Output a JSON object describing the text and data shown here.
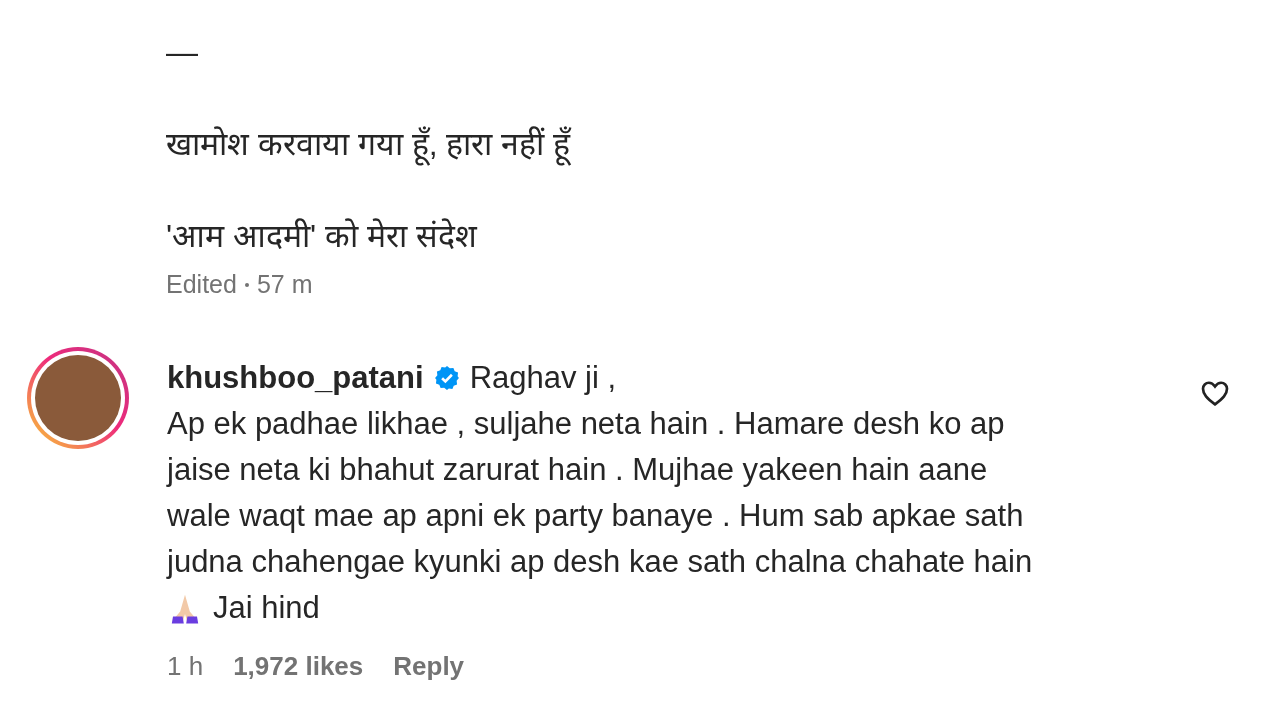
{
  "caption": {
    "lines": [
      "—",
      "खामोश करवाया गया हूँ, हारा नहीं हूँ",
      "'आम आदमी' को मेरा संदेश"
    ],
    "edited": "Edited",
    "time": "57 m"
  },
  "comment": {
    "username": "khushboo_patani",
    "verified": true,
    "liked": false,
    "lines": [
      "Raghav ji ,",
      "Ap ek padhae likhae , suljahe neta hain . Hamare desh ko ap",
      "jaise neta ki bhahut zarurat hain . Mujhae yakeen hain aane",
      "wale waqt mae ap apni ek party banaye . Hum sab apkae sath",
      "judna chahengae kyunki ap desh kae sath chalna chahate hain",
      "Jai hind"
    ],
    "time": "1 h",
    "likes": "1,972 likes",
    "reply": "Reply"
  }
}
